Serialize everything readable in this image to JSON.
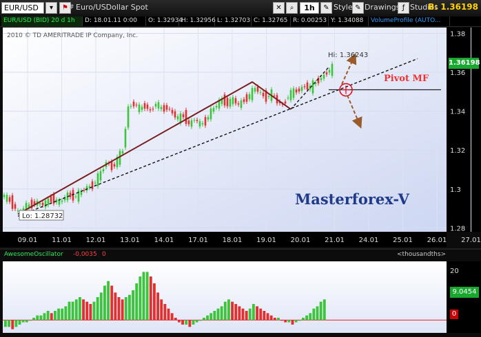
{
  "toolbar": {
    "symbol": "EUR/USD",
    "description": "Euro/USDollar Spot",
    "timeframe": "1h",
    "style_label": "Style",
    "drawings_label": "Drawings",
    "studies_label": "Studies",
    "bid": "B: 1.36198"
  },
  "infobar": {
    "symbol": "EUR/USD (BID) 20 d 1h",
    "date": "D: 18.01.11 0:00",
    "open": "O: 1.32934",
    "high": "H: 1.32956",
    "low": "L: 1.32703",
    "close": "C: 1.32765",
    "range": "R: 0.00253",
    "y": "Y: 1.34088",
    "volume_profile": "VolumeProfile (AUTO..."
  },
  "copyright": "2010 © TD AMERITRADE IP Company, Inc.",
  "annotations": {
    "hi": "Hi: 1.36243",
    "lo": "Lo: 1.28732",
    "pivot": "Pivot MF",
    "brand": "Masterforex-V"
  },
  "price_label": "1.36198",
  "oscillator": {
    "name": "AwesomeOscillator",
    "value": "-0.0035",
    "zero": "0",
    "units": "<thousandths>",
    "current_value": "9.0454",
    "zero_marker": "0",
    "ymax_label": "20"
  },
  "colors": {
    "up": "#3cc43c",
    "down": "#e03030",
    "line": "#7a1f1f",
    "accent": "#2b9dff"
  },
  "chart_data": [
    {
      "type": "candlestick",
      "x_tick_labels": [
        "09.01",
        "11.01",
        "12.01",
        "13.01",
        "14.01",
        "17.01",
        "18.01",
        "19.01",
        "20.01",
        "21.01",
        "24.01",
        "25.01",
        "26.01",
        "27.01"
      ],
      "y_tick_labels": [
        "1.38",
        "1.36",
        "1.34",
        "1.32",
        "1.3",
        "1.28"
      ],
      "ylim": [
        1.278,
        1.383
      ],
      "x_index_range": [
        0,
        160
      ],
      "last_price": 1.36198,
      "hi": 1.36243,
      "lo": 1.28732,
      "close_path": [
        [
          0,
          1.297
        ],
        [
          3,
          1.294
        ],
        [
          6,
          1.288
        ],
        [
          9,
          1.291
        ],
        [
          12,
          1.293
        ],
        [
          15,
          1.292
        ],
        [
          18,
          1.295
        ],
        [
          21,
          1.293
        ],
        [
          24,
          1.297
        ],
        [
          27,
          1.296
        ],
        [
          30,
          1.3
        ],
        [
          33,
          1.302
        ],
        [
          36,
          1.308
        ],
        [
          38,
          1.314
        ],
        [
          40,
          1.311
        ],
        [
          42,
          1.315
        ],
        [
          44,
          1.32
        ],
        [
          45,
          1.332
        ],
        [
          46,
          1.342
        ],
        [
          48,
          1.344
        ],
        [
          50,
          1.341
        ],
        [
          52,
          1.343
        ],
        [
          54,
          1.34
        ],
        [
          56,
          1.344
        ],
        [
          58,
          1.341
        ],
        [
          60,
          1.342
        ],
        [
          62,
          1.339
        ],
        [
          64,
          1.336
        ],
        [
          66,
          1.338
        ],
        [
          68,
          1.333
        ],
        [
          70,
          1.336
        ],
        [
          72,
          1.333
        ],
        [
          74,
          1.335
        ],
        [
          76,
          1.34
        ],
        [
          78,
          1.343
        ],
        [
          80,
          1.346
        ],
        [
          82,
          1.344
        ],
        [
          84,
          1.346
        ],
        [
          86,
          1.343
        ],
        [
          88,
          1.346
        ],
        [
          90,
          1.348
        ],
        [
          92,
          1.352
        ],
        [
          94,
          1.349
        ],
        [
          96,
          1.347
        ],
        [
          98,
          1.349
        ],
        [
          100,
          1.345
        ],
        [
          102,
          1.343
        ],
        [
          104,
          1.348
        ],
        [
          106,
          1.35
        ],
        [
          108,
          1.351
        ],
        [
          110,
          1.353
        ],
        [
          112,
          1.352
        ],
        [
          114,
          1.355
        ],
        [
          116,
          1.357
        ],
        [
          118,
          1.36
        ],
        [
          120,
          1.362
        ]
      ],
      "trend_lines": [
        {
          "style": "solid",
          "points": [
            [
              5,
              1.287
            ],
            [
              90,
              1.355
            ],
            [
              104,
              1.341
            ]
          ]
        },
        {
          "style": "dashed",
          "points": [
            [
              5,
              1.286
            ],
            [
              150,
              1.367
            ]
          ]
        },
        {
          "style": "dashed",
          "points": [
            [
              104,
              1.341
            ],
            [
              118,
              1.363
            ]
          ]
        }
      ],
      "pivot_level": 1.351,
      "pivot_x": 124
    },
    {
      "type": "bar",
      "name": "AwesomeOscillator",
      "ylim": [
        -5,
        25
      ],
      "y_tick_labels": [
        "20"
      ],
      "values": [
        -3,
        -3,
        -4,
        -3,
        -2,
        -1,
        -1,
        0,
        1,
        2,
        2,
        3,
        4,
        3,
        4,
        5,
        5,
        6,
        8,
        8,
        9,
        10,
        9,
        8,
        7,
        8,
        10,
        12,
        15,
        17,
        15,
        12,
        10,
        9,
        10,
        11,
        13,
        16,
        19,
        21,
        21,
        19,
        16,
        12,
        9,
        7,
        5,
        3,
        1,
        -1,
        -2,
        -2,
        -3,
        -2,
        -1,
        0,
        1,
        2,
        3,
        4,
        5,
        6,
        8,
        9,
        8,
        7,
        6,
        5,
        4,
        5,
        7,
        6,
        5,
        4,
        3,
        2,
        1,
        1,
        0,
        -1,
        -1,
        -2,
        -1,
        0,
        1,
        2,
        3,
        5,
        6,
        8,
        9
      ]
    }
  ]
}
